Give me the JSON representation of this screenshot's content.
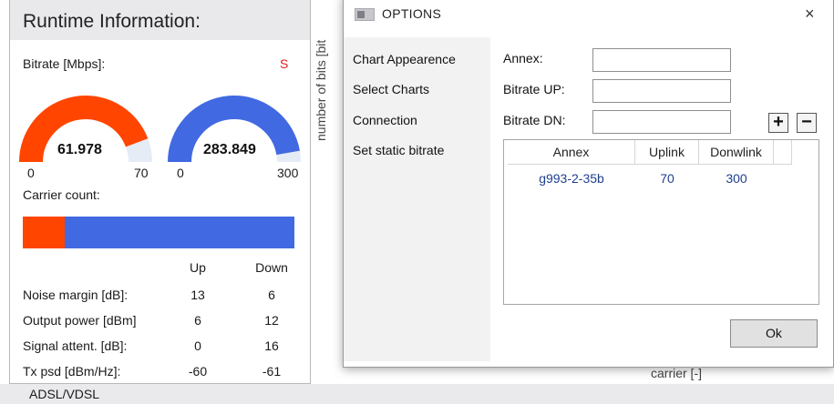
{
  "runtime": {
    "title": "Runtime Information:",
    "bitrate_label": "Bitrate [Mbps]:",
    "bitrate_flag": "S",
    "gauge_up": {
      "value": "61.978",
      "min": "0",
      "max": "70",
      "fraction": 0.885
    },
    "gauge_down": {
      "value": "283.849",
      "min": "0",
      "max": "300",
      "fraction": 0.946
    },
    "carrier_label": "Carrier count:",
    "carrier_fraction": 0.155,
    "col_up": "Up",
    "col_down": "Down",
    "rows": [
      {
        "label": "Noise margin [dB]:",
        "up": "13",
        "down": "6"
      },
      {
        "label": "Output power [dBm]",
        "up": "6",
        "down": "12"
      },
      {
        "label": "Signal attent. [dB]:",
        "up": "0",
        "down": "16"
      },
      {
        "label": "Tx psd [dBm/Hz]:",
        "up": "-60",
        "down": "-61"
      }
    ],
    "colors": {
      "up": "#ff4500",
      "down": "#4169e1",
      "track": "#e6ecf5"
    }
  },
  "status_bar": {
    "text": "ADSL/VDSL"
  },
  "chart": {
    "y_label": "number of bits [bit",
    "x_label": "carrier [-]"
  },
  "dialog": {
    "title": "OPTIONS",
    "close": "×",
    "nav": [
      "Chart Appearence",
      "Select Charts",
      "Connection",
      "Set static bitrate"
    ],
    "fields": [
      {
        "label": "Annex:",
        "value": ""
      },
      {
        "label": "Bitrate UP:",
        "value": ""
      },
      {
        "label": "Bitrate DN:",
        "value": ""
      }
    ],
    "add_label": "+",
    "remove_label": "−",
    "table": {
      "headers": [
        "Annex",
        "Uplink",
        "Donwlink"
      ],
      "rows": [
        {
          "annex": "g993-2-35b",
          "uplink": "70",
          "downlink": "300"
        }
      ]
    },
    "ok_label": "Ok"
  }
}
